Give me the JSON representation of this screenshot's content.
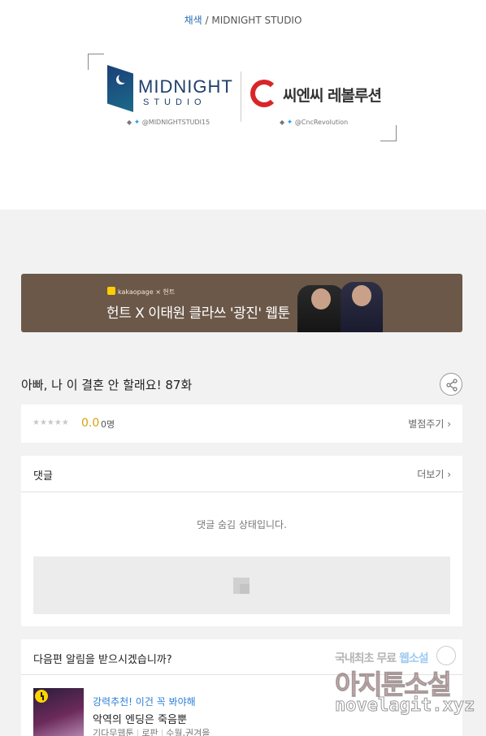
{
  "credit": {
    "colorist": "채색",
    "separator": " / ",
    "studio": "MIDNIGHT STUDIO"
  },
  "logos": {
    "midnight_name": "MIDNIGHT",
    "midnight_sub": "STUDIO",
    "midnight_twitter": "@MIDNIGHTSTUDI15",
    "cnc_name": "씨엔씨 레볼루션",
    "cnc_twitter": "@CncRevolution",
    "twitter_bullet": "◆"
  },
  "banner": {
    "publisher": "kakaopage",
    "cross": " × ",
    "brand": "헌트",
    "headline": "헌트 X 이태원 클라쓰 '광진' 웹툰"
  },
  "episode": {
    "title": "아빠, 나 이 결혼 안 할래요! 87화"
  },
  "rating": {
    "stars": "★★★★★",
    "score": "0.0",
    "count": "0명",
    "rate_link": "별점주기 ›"
  },
  "comments": {
    "title": "댓글",
    "more": "더보기 ›",
    "hidden_notice": "댓글 숨김 상태입니다."
  },
  "next_alert": {
    "title": "다음편 알림을 받으시겠습니까?"
  },
  "recommendation": {
    "tag": "강력추천! 이건 꼭 봐야해",
    "title": "악역의 엔딩은 죽음뿐",
    "meta": [
      "기다무웹툰",
      "로판",
      "수월,권겨을"
    ]
  },
  "watermark": {
    "line1_prefix": "국내최초 무료 ",
    "line1_highlight": "웹소설",
    "line2": "아지툰소설",
    "line3": "novelagit.xyz"
  }
}
